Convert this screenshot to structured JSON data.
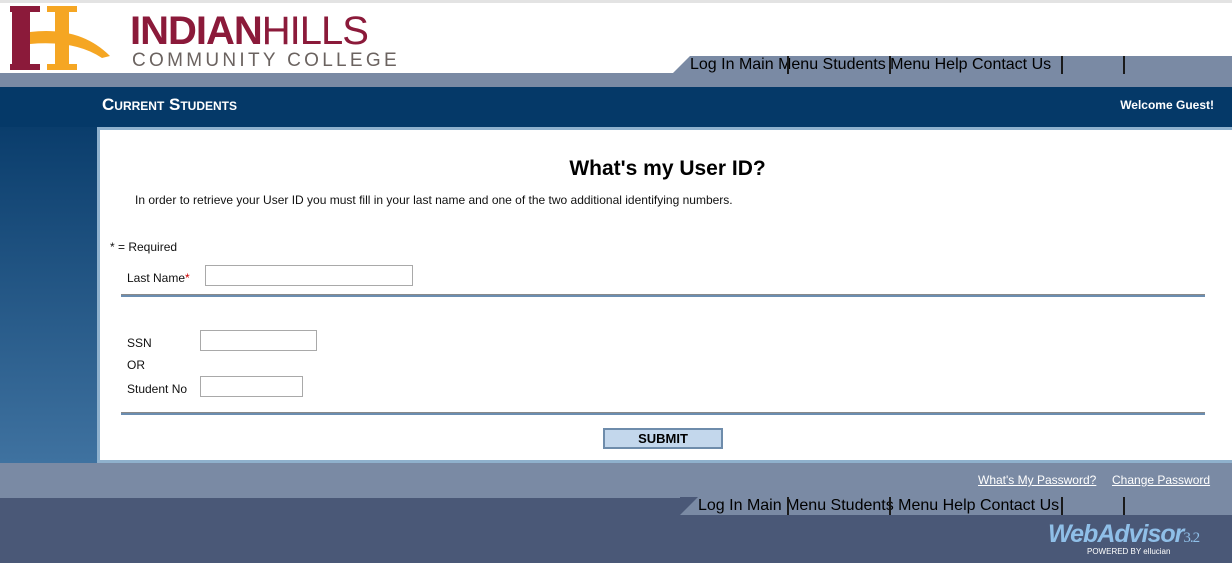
{
  "header": {
    "logo_text": "INDIAN HILLS",
    "logo_sub": "COMMUNITY COLLEGE",
    "section_title": "Current Students",
    "welcome": "Welcome Guest!"
  },
  "nav": [
    "Log In",
    "Main Menu",
    "Students Menu",
    "Help",
    "Contact Us"
  ],
  "colors": {
    "navy": "#053968",
    "nav_gray": "#7a8aa4",
    "maroon": "#8b1a3a",
    "gold": "#f5a623"
  },
  "form": {
    "heading": "What's my User ID?",
    "intro": "In order to retrieve your User ID you must fill in your last name and one of the two additional identifying numbers.",
    "required_note": "* = Required",
    "last_name_label": "Last Name",
    "required_mark": "*",
    "last_name_value": "",
    "ssn_label": "SSN",
    "ssn_value": "",
    "or_label": "OR",
    "student_no_label": "Student No",
    "student_no_value": "",
    "submit": "SUBMIT"
  },
  "footer": {
    "whats_password": "What's My Password?",
    "change_password": "Change Password",
    "brand": "WebAdvisor",
    "version": "3.2",
    "powered": "POWERED BY ellucian"
  }
}
